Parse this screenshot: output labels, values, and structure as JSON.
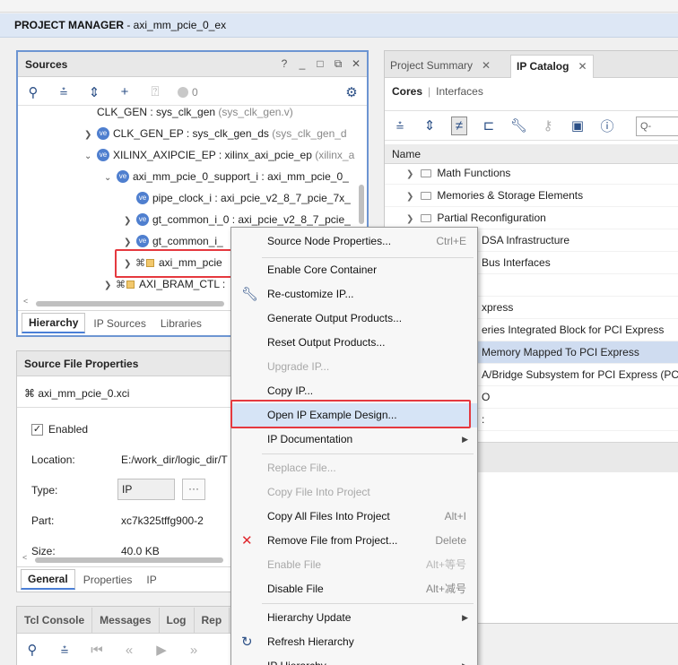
{
  "header": {
    "bold": "PROJECT MANAGER",
    "rest": " - axi_mm_pcie_0_ex"
  },
  "sources": {
    "title": "Sources",
    "win_buttons": [
      "?",
      "_",
      "□",
      "⧉",
      "✕"
    ],
    "count": "0",
    "tree": [
      {
        "label": "CLK_GEN : sys_clk_gen",
        "sub": " (sys_clk_gen.v)"
      },
      {
        "label": "CLK_GEN_EP : sys_clk_gen_ds",
        "sub": " (sys_clk_gen_d"
      },
      {
        "label": "XILINX_AXIPCIE_EP : xilinx_axi_pcie_ep",
        "sub": " (xilinx_a"
      },
      {
        "label": "axi_mm_pcie_0_support_i : axi_mm_pcie_0_",
        "sub": ""
      },
      {
        "label": "pipe_clock_i : axi_pcie_v2_8_7_pcie_7x_",
        "sub": ""
      },
      {
        "label": "gt_common_i_0 : axi_pcie_v2_8_7_pcie_",
        "sub": ""
      },
      {
        "label": "gt_common_i_",
        "sub": ""
      },
      {
        "label": "axi_mm_pcie",
        "sub": ""
      },
      {
        "label": "AXI_BRAM_CTL :",
        "sub": ""
      }
    ],
    "tabs": [
      "Hierarchy",
      "IP Sources",
      "Libraries"
    ]
  },
  "props": {
    "title": "Source File Properties",
    "file": "axi_mm_pcie_0.xci",
    "enabled_label": "Enabled",
    "location_label": "Location:",
    "location_value": "E:/work_dir/logic_dir/T",
    "type_label": "Type:",
    "type_value": "IP",
    "part_label": "Part:",
    "part_value": "xc7k325tffg900-2",
    "size_label": "Size:",
    "size_value": "40.0 KB",
    "tabs": [
      "General",
      "Properties",
      "IP"
    ]
  },
  "tcl": {
    "tabs": [
      "Tcl Console",
      "Messages",
      "Log",
      "Rep"
    ]
  },
  "right": {
    "tabs": [
      "Project Summary",
      "IP Catalog"
    ],
    "cores": "Cores",
    "interfaces": "Interfaces",
    "search_placeholder": "Q-",
    "col_name": "Name",
    "rows": [
      "Math Functions",
      "Memories & Storage Elements",
      "Partial Reconfiguration",
      "DSA Infrastructure",
      "Bus Interfaces",
      "",
      "xpress",
      "eries Integrated Block for PCI Express",
      "Memory Mapped To PCI Express",
      "A/Bridge Subsystem for PCI Express (PC",
      "O",
      ":"
    ]
  },
  "menu": {
    "items": [
      {
        "label": "Source Node Properties...",
        "shortcut": "Ctrl+E",
        "disabled": false
      },
      {
        "label": "Enable Core Container",
        "shortcut": "",
        "disabled": false
      },
      {
        "label": "Re-customize IP...",
        "shortcut": "",
        "disabled": false
      },
      {
        "label": "Generate Output Products...",
        "shortcut": "",
        "disabled": false
      },
      {
        "label": "Reset Output Products...",
        "shortcut": "",
        "disabled": false
      },
      {
        "label": "Upgrade IP...",
        "shortcut": "",
        "disabled": true
      },
      {
        "label": "Copy IP...",
        "shortcut": "",
        "disabled": false
      },
      {
        "label": "Open IP Example Design...",
        "shortcut": "",
        "disabled": false
      },
      {
        "label": "IP Documentation",
        "shortcut": "",
        "disabled": false
      },
      {
        "label": "Replace File...",
        "shortcut": "",
        "disabled": true
      },
      {
        "label": "Copy File Into Project",
        "shortcut": "",
        "disabled": true
      },
      {
        "label": "Copy All Files Into Project",
        "shortcut": "Alt+I",
        "disabled": false
      },
      {
        "label": "Remove File from Project...",
        "shortcut": "Delete",
        "disabled": false
      },
      {
        "label": "Enable File",
        "shortcut": "Alt+等号",
        "disabled": true
      },
      {
        "label": "Disable File",
        "shortcut": "Alt+减号",
        "disabled": false
      },
      {
        "label": "Hierarchy Update",
        "shortcut": "",
        "disabled": false
      },
      {
        "label": "Refresh Hierarchy",
        "shortcut": "",
        "disabled": false
      },
      {
        "label": "IP Hierarchy",
        "shortcut": "",
        "disabled": false
      }
    ]
  },
  "colors": {
    "accent_blue": "#4a7fd6",
    "highlight_red": "#e5393f",
    "selection": "#cfdcf0"
  }
}
